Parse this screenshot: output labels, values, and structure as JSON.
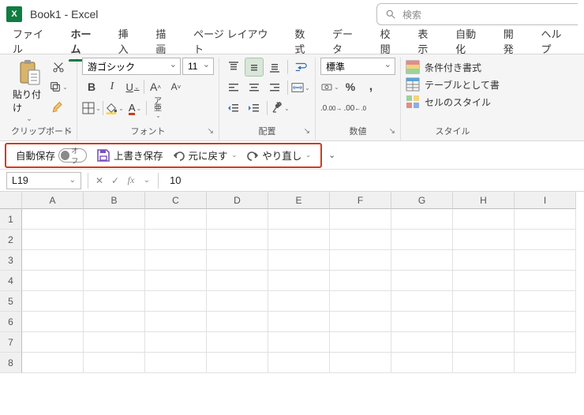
{
  "title": "Book1  -  Excel",
  "search_placeholder": "検索",
  "tabs": [
    "ファイル",
    "ホーム",
    "挿入",
    "描画",
    "ページ レイアウト",
    "数式",
    "データ",
    "校閲",
    "表示",
    "自動化",
    "開発",
    "ヘルプ"
  ],
  "active_tab": "ホーム",
  "ribbon": {
    "clipboard": {
      "paste": "貼り付け",
      "label": "クリップボード"
    },
    "font": {
      "name": "游ゴシック",
      "size": "11",
      "label": "フォント"
    },
    "alignment": {
      "label": "配置"
    },
    "number": {
      "format": "標準",
      "label": "数値"
    },
    "styles": {
      "cond": "条件付き書式 ",
      "table": "テーブルとして書",
      "cell": "セルのスタイル ",
      "label": "スタイル"
    }
  },
  "qat": {
    "autosave_label": "自動保存",
    "autosave_state": "オフ",
    "save": "上書き保存",
    "undo": "元に戻す",
    "redo": "やり直し"
  },
  "namebox": "L19",
  "formula_value": "10",
  "columns": [
    "A",
    "B",
    "C",
    "D",
    "E",
    "F",
    "G",
    "H",
    "I"
  ],
  "rows": [
    "1",
    "2",
    "3",
    "4",
    "5",
    "6",
    "7",
    "8"
  ]
}
